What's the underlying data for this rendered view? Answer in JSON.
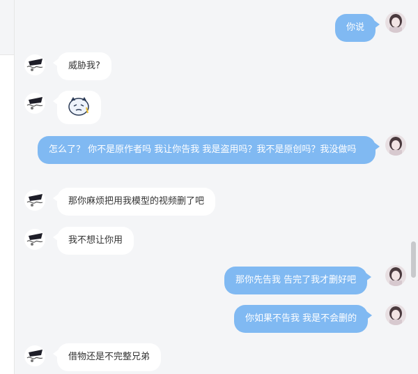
{
  "colors": {
    "outgoing_bubble": "#80b9f2",
    "incoming_bubble": "#ffffff",
    "background": "#f4f5f7"
  },
  "messages": [
    {
      "direction": "out",
      "text": "你说",
      "avatar": "user-avatar"
    },
    {
      "direction": "in",
      "text": "威胁我?",
      "avatar": "contact-avatar"
    },
    {
      "direction": "in",
      "sticker": "crying-face-sticker",
      "avatar": "contact-avatar"
    },
    {
      "direction": "out",
      "text": "怎么了？ 你不是原作者吗 我让你告我 我是盗用吗？我不是原创吗？我没做吗",
      "avatar": "user-avatar"
    },
    {
      "direction": "in",
      "text": "那你麻烦把用我模型的视频删了吧",
      "avatar": "contact-avatar"
    },
    {
      "direction": "in",
      "text": "我不想让你用",
      "avatar": "contact-avatar"
    },
    {
      "direction": "out",
      "text": "那你先告我 告完了我才删好吧",
      "avatar": "user-avatar"
    },
    {
      "direction": "out",
      "text": "你如果不告我 我是不会删的",
      "avatar": "user-avatar"
    },
    {
      "direction": "in",
      "text": "借物还是不完整兄弟",
      "avatar": "contact-avatar"
    }
  ]
}
